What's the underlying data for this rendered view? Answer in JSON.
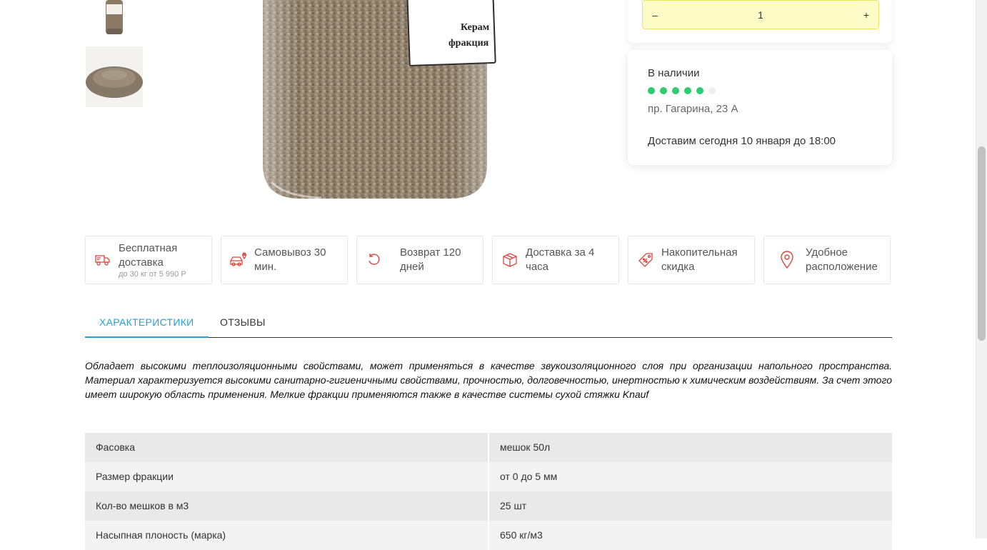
{
  "quantity": {
    "decrement": "–",
    "value": "1",
    "increment": "+"
  },
  "stock": {
    "title": "В наличии",
    "rating_filled": 5,
    "rating_total": 6,
    "address": "пр. Гагарина, 23 А",
    "delivery": "Доставим сегодня 10 января до 18:00"
  },
  "product_label": {
    "line1": "Керам",
    "line2": "фракция"
  },
  "features": [
    {
      "icon": "truck-icon",
      "title": "Бесплатная доставка",
      "note": "до 30 кг от 5 990 Р"
    },
    {
      "icon": "car-location-icon",
      "title": "Самовывоз 30 мин.",
      "note": ""
    },
    {
      "icon": "return-icon",
      "title": "Возврат 120 дней",
      "note": ""
    },
    {
      "icon": "box-icon",
      "title": "Доставка за 4 часа",
      "note": ""
    },
    {
      "icon": "discount-tag-icon",
      "title": "Накопительная скидка",
      "note": ""
    },
    {
      "icon": "location-pin-icon",
      "title": "Удобное расположение",
      "note": ""
    }
  ],
  "tabs": [
    {
      "label": "ХАРАКТЕРИСТИКИ",
      "active": true
    },
    {
      "label": "ОТЗЫВЫ",
      "active": false
    }
  ],
  "description": "Обладает высокими теплоизоляционными свойствами, может применяться в качестве звукоизоляционного слоя при организации напольного пространства. Материал характеризуется высокими санитарно-гигиеничными свойствами, прочностью, долговечностью, инертностью к химическим воздействиям. За счет этого имеет широкую область применения. Мелкие фракции применяются также в качестве системы сухой стяжки Knauf",
  "specs": [
    {
      "name": "Фасовка",
      "value": "мешок 50л"
    },
    {
      "name": "Размер фракции",
      "value": "от 0 до 5 мм"
    },
    {
      "name": "Кол-во мешков в м3",
      "value": "25 шт"
    },
    {
      "name": "Насыпная плоность (марка)",
      "value": "650 кг/м3"
    }
  ],
  "colors": {
    "accent": "#2a9fd6",
    "icon_red": "#e0443f",
    "in_stock": "#2ecc71",
    "qty_bg": "#fdfbc6"
  }
}
